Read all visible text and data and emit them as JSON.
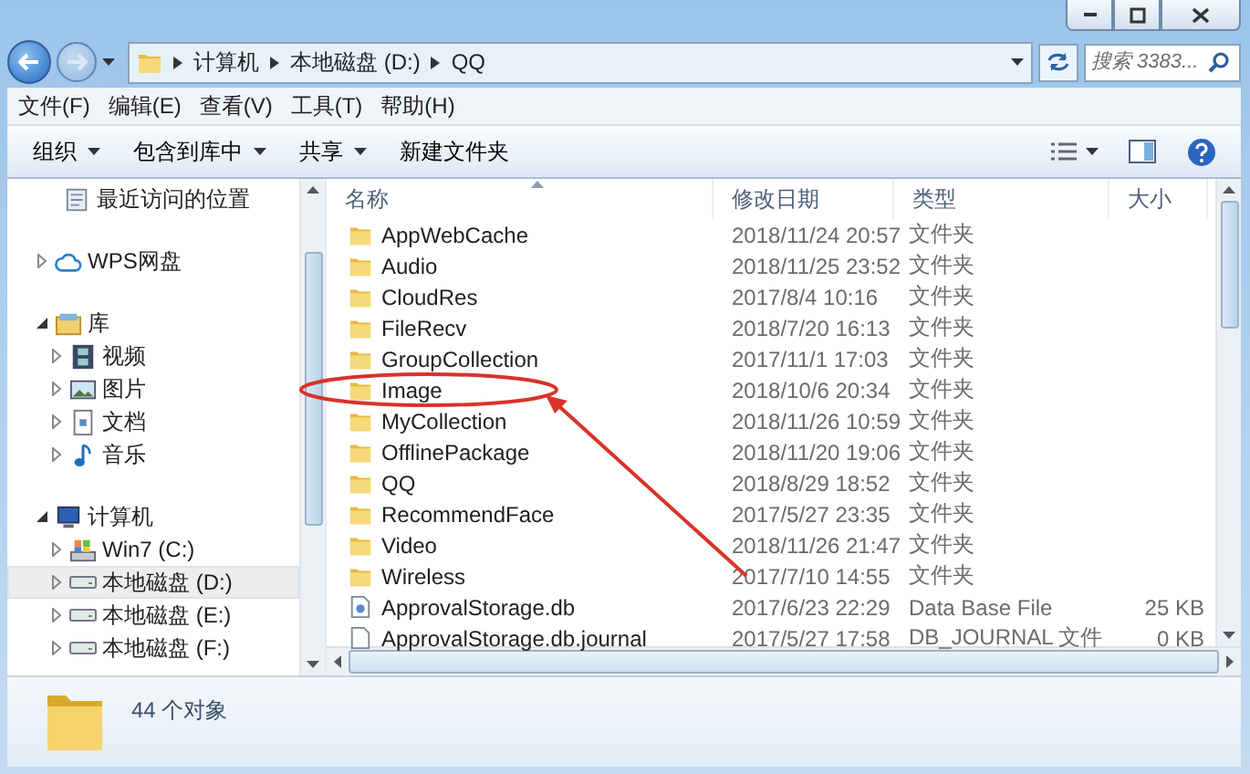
{
  "address_bar": {
    "segments": [
      "计算机",
      "本地磁盘 (D:)",
      "QQ"
    ]
  },
  "search": {
    "placeholder": "搜索 3383..."
  },
  "menu_bar": [
    "文件(F)",
    "编辑(E)",
    "查看(V)",
    "工具(T)",
    "帮助(H)"
  ],
  "toolbar": [
    {
      "label": "组织",
      "has_menu": true
    },
    {
      "label": "包含到库中",
      "has_menu": true
    },
    {
      "label": "共享",
      "has_menu": true
    },
    {
      "label": "新建文件夹",
      "has_menu": false
    }
  ],
  "sidebar": {
    "items": [
      {
        "label": "最近访问的位置",
        "kind": "recent",
        "selected": false
      },
      {
        "label": "WPS网盘",
        "kind": "cloud",
        "expanded": false,
        "selected": false
      },
      {
        "label": "库",
        "kind": "library",
        "expanded": true,
        "selected": false,
        "children": [
          {
            "label": "视频",
            "kind": "video",
            "expanded": false,
            "selected": false
          },
          {
            "label": "图片",
            "kind": "picture",
            "expanded": false,
            "selected": false
          },
          {
            "label": "文档",
            "kind": "document",
            "expanded": false,
            "selected": false
          },
          {
            "label": "音乐",
            "kind": "music",
            "expanded": false,
            "selected": false
          }
        ]
      },
      {
        "label": "计算机",
        "kind": "computer",
        "expanded": true,
        "selected": false,
        "children": [
          {
            "label": "Win7 (C:)",
            "kind": "system_drive",
            "expanded": false,
            "selected": false
          },
          {
            "label": "本地磁盘 (D:)",
            "kind": "drive",
            "expanded": false,
            "selected": true
          },
          {
            "label": "本地磁盘 (E:)",
            "kind": "drive",
            "expanded": false,
            "selected": false
          },
          {
            "label": "本地磁盘 (F:)",
            "kind": "drive",
            "expanded": false,
            "selected": false
          }
        ]
      }
    ]
  },
  "table": {
    "columns": [
      "名称",
      "修改日期",
      "类型",
      "大小"
    ],
    "rows": [
      {
        "name": "AppWebCache",
        "date": "2018/11/24 20:57",
        "type": "文件夹",
        "kind": "folder",
        "highlighted": false
      },
      {
        "name": "Audio",
        "date": "2018/11/25 23:52",
        "type": "文件夹",
        "kind": "folder",
        "highlighted": false
      },
      {
        "name": "CloudRes",
        "date": "2017/8/4 10:16",
        "type": "文件夹",
        "kind": "folder",
        "highlighted": false
      },
      {
        "name": "FileRecv",
        "date": "2018/7/20 16:13",
        "type": "文件夹",
        "kind": "folder",
        "highlighted": false
      },
      {
        "name": "GroupCollection",
        "date": "2017/11/1 17:03",
        "type": "文件夹",
        "kind": "folder",
        "highlighted": false
      },
      {
        "name": "Image",
        "date": "2018/10/6 20:34",
        "type": "文件夹",
        "kind": "folder",
        "highlighted": true
      },
      {
        "name": "MyCollection",
        "date": "2018/11/26 10:59",
        "type": "文件夹",
        "kind": "folder",
        "highlighted": false
      },
      {
        "name": "OfflinePackage",
        "date": "2018/11/20 19:06",
        "type": "文件夹",
        "kind": "folder",
        "highlighted": false
      },
      {
        "name": "QQ",
        "date": "2018/8/29 18:52",
        "type": "文件夹",
        "kind": "folder",
        "highlighted": false
      },
      {
        "name": "RecommendFace",
        "date": "2017/5/27 23:35",
        "type": "文件夹",
        "kind": "folder",
        "highlighted": false
      },
      {
        "name": "Video",
        "date": "2018/11/26 21:47",
        "type": "文件夹",
        "kind": "folder",
        "highlighted": false
      },
      {
        "name": "Wireless",
        "date": "2017/7/10 14:55",
        "type": "文件夹",
        "kind": "folder",
        "highlighted": false
      },
      {
        "name": "ApprovalStorage.db",
        "date": "2017/6/23 22:29",
        "type": "Data Base File",
        "size": "25 KB",
        "kind": "db_file",
        "highlighted": false
      },
      {
        "name": "ApprovalStorage.db.journal",
        "date": "2017/5/27 17:58",
        "type": "DB_JOURNAL 文件",
        "size": "0 KB",
        "kind": "file",
        "highlighted": false
      }
    ]
  },
  "status_bar": {
    "text": "44 个对象"
  }
}
